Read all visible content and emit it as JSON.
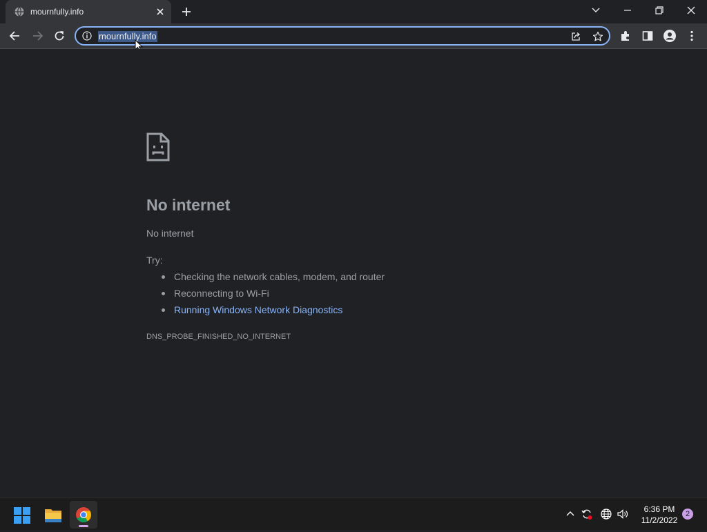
{
  "browser": {
    "tab": {
      "title": "mournfully.info",
      "favicon": "globe-icon"
    },
    "omnibox": {
      "url": "mournfully.info",
      "selected": true
    }
  },
  "error_page": {
    "title": "No internet",
    "subtitle": "No internet",
    "try_label": "Try:",
    "suggestions": [
      {
        "text": "Checking the network cables, modem, and router",
        "link": false
      },
      {
        "text": "Reconnecting to Wi-Fi",
        "link": false
      },
      {
        "text": "Running Windows Network Diagnostics",
        "link": true
      }
    ],
    "error_code": "DNS_PROBE_FINISHED_NO_INTERNET"
  },
  "taskbar": {
    "apps": [
      "start-icon",
      "file-explorer-icon",
      "chrome-icon"
    ],
    "clock": {
      "time": "6:36 PM",
      "date": "11/2/2022"
    },
    "notifications": "2"
  },
  "colors": {
    "background": "#202124",
    "toolbar": "#35363a",
    "accent": "#8ab4f8",
    "text_muted": "#9aa0a6"
  }
}
